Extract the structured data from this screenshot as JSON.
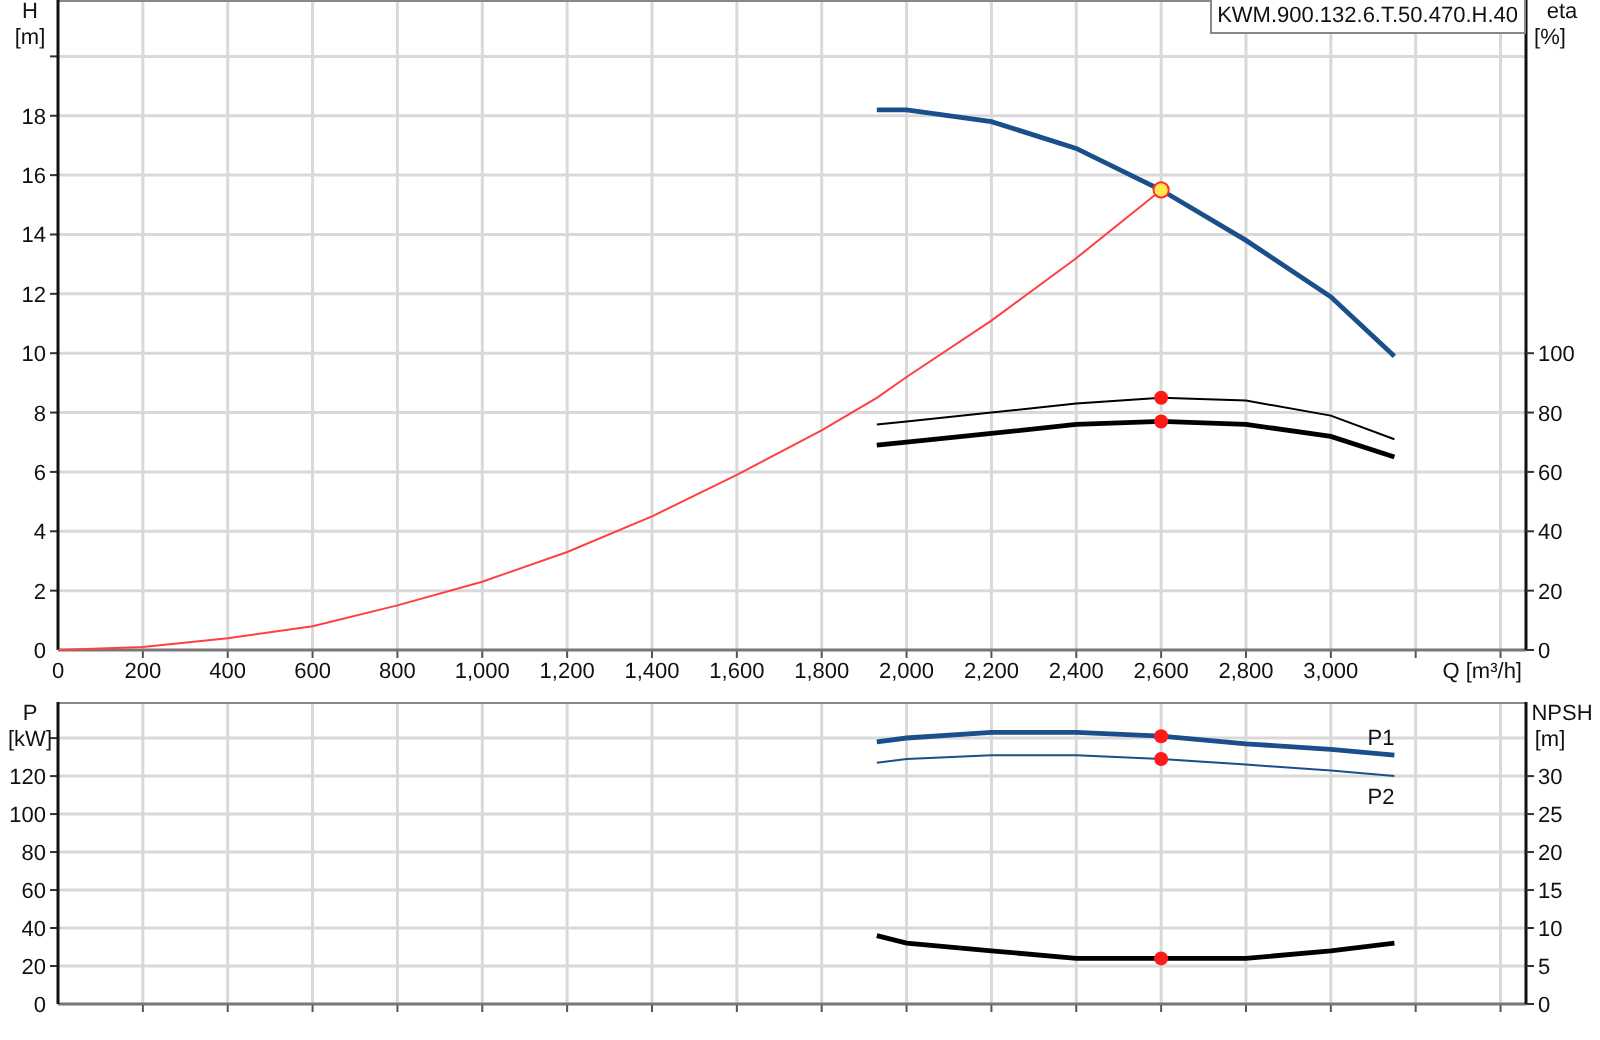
{
  "title_box": "KWM.900.132.6.T.50.470.H.40",
  "charts": [
    {
      "chart_data": {
        "type": "line",
        "xlabel": "Q [m³/h]",
        "ylabel": "H [m]",
        "y2label": "eta [%]",
        "xlim": [
          0,
          3460
        ],
        "ylim": [
          0,
          21.9
        ],
        "y2lim": [
          0,
          219
        ],
        "xticks": [
          {
            "value": 0,
            "label": "0"
          },
          {
            "value": 200,
            "label": "200"
          },
          {
            "value": 400,
            "label": "400"
          },
          {
            "value": 600,
            "label": "600"
          },
          {
            "value": 800,
            "label": "800"
          },
          {
            "value": 1000,
            "label": "1,000"
          },
          {
            "value": 1200,
            "label": "1,200"
          },
          {
            "value": 1400,
            "label": "1,400"
          },
          {
            "value": 1600,
            "label": "1,600"
          },
          {
            "value": 1800,
            "label": "1,800"
          },
          {
            "value": 2000,
            "label": "2,000"
          },
          {
            "value": 2200,
            "label": "2,200"
          },
          {
            "value": 2400,
            "label": "2,400"
          },
          {
            "value": 2600,
            "label": "2,600"
          },
          {
            "value": 2800,
            "label": "2,800"
          },
          {
            "value": 3000,
            "label": "3,000"
          }
        ],
        "yticks": [
          0,
          2,
          4,
          6,
          8,
          10,
          12,
          14,
          16,
          18
        ],
        "y2ticks": [
          0,
          20,
          40,
          60,
          80,
          100
        ],
        "x": [
          0,
          200,
          400,
          600,
          800,
          1000,
          1200,
          1400,
          1600,
          1800,
          1930,
          2000,
          2200,
          2400,
          2600,
          2800,
          3000,
          3150
        ],
        "series": [
          {
            "color": "#ff4040",
            "values": [
              0,
              0.1,
              0.4,
              0.8,
              1.5,
              2.3,
              3.3,
              4.5,
              5.9,
              7.4,
              8.5,
              9.2,
              11.1,
              13.2,
              15.5,
              null,
              null,
              null
            ]
          },
          {
            "color": "#1a4f8b",
            "values": [
              null,
              null,
              null,
              null,
              null,
              null,
              null,
              null,
              null,
              null,
              18.2,
              18.2,
              17.8,
              16.9,
              15.5,
              13.8,
              11.9,
              9.9
            ]
          },
          {
            "color": "#000000",
            "axis": "y2",
            "values": [
              null,
              null,
              null,
              null,
              null,
              null,
              null,
              null,
              null,
              null,
              76,
              77,
              80,
              83,
              85,
              84,
              79,
              71
            ]
          },
          {
            "color": "#000000",
            "axis": "y2",
            "values": [
              null,
              null,
              null,
              null,
              null,
              null,
              null,
              null,
              null,
              null,
              69,
              70,
              73,
              76,
              77,
              76,
              72,
              65
            ]
          }
        ],
        "grid": true
      }
    },
    {
      "chart_data": {
        "type": "line",
        "ylabel": "P [kW]",
        "y2label": "NPSH [m]",
        "xlim": [
          0,
          3460
        ],
        "ylim": [
          0,
          159
        ],
        "y2lim": [
          0,
          39.75
        ],
        "yticks": [
          0,
          20,
          40,
          60,
          80,
          100,
          120
        ],
        "y2ticks": [
          0,
          5,
          10,
          15,
          20,
          25,
          30
        ],
        "x": [
          1930,
          2000,
          2200,
          2400,
          2600,
          2800,
          3000,
          3150
        ],
        "series": [
          {
            "name": "P1",
            "color": "#1a4f8b",
            "values": [
              138,
              140,
              143,
              143,
              141,
              137,
              134,
              131
            ]
          },
          {
            "name": "P2",
            "color": "#1a4f8b",
            "values": [
              127,
              129,
              131,
              131,
              129,
              126,
              123,
              120
            ]
          },
          {
            "color": "#000000",
            "axis": "y2",
            "values": [
              9,
              8,
              7,
              6,
              6,
              6,
              7,
              8
            ]
          }
        ],
        "grid": true
      }
    }
  ]
}
